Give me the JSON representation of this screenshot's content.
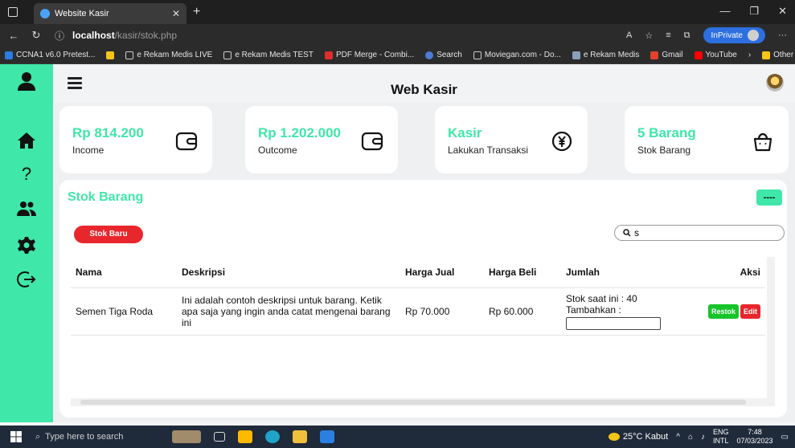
{
  "browser": {
    "tab_title": "Website Kasir",
    "url_host": "localhost",
    "url_path": "/kasir/stok.php",
    "inprivate_label": "InPrivate",
    "bookmarks": [
      "CCNA1 v6.0 Pretest...",
      "e Rekam Medis LIVE",
      "e Rekam Medis TEST",
      "PDF Merge - Combi...",
      "Search",
      "Moviegan.com - Do...",
      "e Rekam Medis",
      "Gmail",
      "YouTube"
    ],
    "other_favorites": "Other favorites"
  },
  "app": {
    "title": "Web Kasir"
  },
  "cards": [
    {
      "value": "Rp 814.200",
      "label": "Income",
      "icon": "wallet-icon"
    },
    {
      "value": "Rp 1.202.000",
      "label": "Outcome",
      "icon": "wallet-icon"
    },
    {
      "value": "Kasir",
      "label": "Lakukan Transaksi",
      "icon": "yen-exchange-icon"
    },
    {
      "value": "5 Barang",
      "label": "Stok Barang",
      "icon": "bag-icon"
    }
  ],
  "panel": {
    "title": "Stok Barang",
    "corner_button": "----",
    "new_stock_button": "Stok Baru",
    "search_value": "s"
  },
  "table": {
    "headers": [
      "Nama",
      "Deskripsi",
      "Harga Jual",
      "Harga Beli",
      "Jumlah",
      "Aksi"
    ],
    "rows": [
      {
        "nama": "Semen Tiga Roda",
        "deskripsi": "Ini adalah contoh deskripsi untuk barang. Ketik apa saja yang ingin anda catat mengenai barang ini",
        "harga_jual": "Rp 70.000",
        "harga_beli": "Rp 60.000",
        "stok_text": "Stok saat ini : 40",
        "tambahkan_label": "Tambahkan :",
        "restok_label": "Restok",
        "edit_label": "Edit"
      }
    ]
  },
  "taskbar": {
    "search_placeholder": "Type here to search",
    "weather": "25°C Kabut",
    "lang": "ENG",
    "region": "INTL",
    "time": "7:48",
    "date": "07/03/2023"
  },
  "colors": {
    "accent": "#3fe7a8",
    "danger": "#e8272c",
    "success": "#17c42a"
  }
}
